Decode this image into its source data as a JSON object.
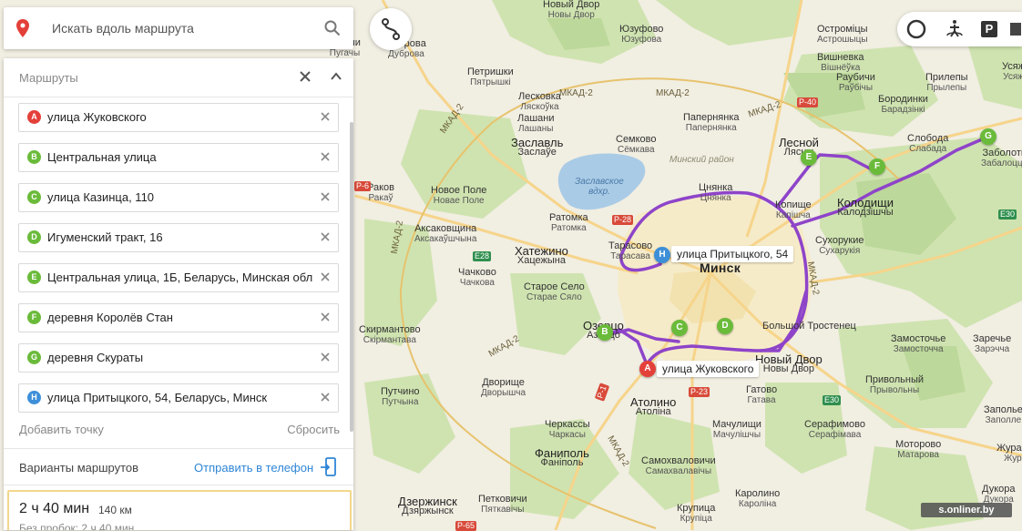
{
  "search": {
    "placeholder": "Искать вдоль маршрута"
  },
  "panel": {
    "title": "Маршруты",
    "waypoints": [
      {
        "letter": "A",
        "text": "улица Жуковского",
        "color": "#e4403a"
      },
      {
        "letter": "B",
        "text": "Центральная улица",
        "color": "#6bbb3b"
      },
      {
        "letter": "C",
        "text": "улица Казинца, 110",
        "color": "#6bbb3b"
      },
      {
        "letter": "D",
        "text": "Игуменский тракт, 16",
        "color": "#6bbb3b"
      },
      {
        "letter": "E",
        "text": "Центральная улица, 1Б, Беларусь, Минская обл",
        "color": "#6bbb3b"
      },
      {
        "letter": "F",
        "text": "деревня Королёв Стан",
        "color": "#6bbb3b"
      },
      {
        "letter": "G",
        "text": "деревня Скураты",
        "color": "#6bbb3b"
      },
      {
        "letter": "H",
        "text": "улица Притыцкого, 54, Беларусь, Минск",
        "color": "#3d8fd8"
      }
    ],
    "add_point": "Добавить точку",
    "reset": "Сбросить",
    "variants_title": "Варианты маршрутов",
    "send_to_phone": "Отправить в телефон",
    "route": {
      "time": "2 ч 40 мин",
      "distance": "140 км",
      "subtitle": "Без пробок: 2 ч 40 мин"
    }
  },
  "top_controls": {
    "parking_label": "P"
  },
  "map": {
    "route_color": "#8e44c9",
    "captions": {
      "a": "улица Жуковского",
      "h": "улица Притыцкого, 54"
    },
    "pins": {
      "a": "A",
      "b": "B",
      "c": "C",
      "d": "D",
      "e": "E",
      "f": "F",
      "g": "G",
      "h": "H"
    },
    "places": [
      {
        "ru": "Новый Двор",
        "by": "Новы Двор"
      },
      {
        "ru": "Юзуфово",
        "by": "Юзуфова"
      },
      {
        "ru": "Остроміцы",
        "by": "Астрошыцы"
      },
      {
        "ru": "Дубровa",
        "by": "Дуброва"
      },
      {
        "ru": "Пугачи",
        "by": "Пугачы"
      },
      {
        "ru": "Вишневка",
        "by": "Вішнёўка"
      },
      {
        "ru": "Петришки",
        "by": "Пятрышкі"
      },
      {
        "ru": "Лесковка",
        "by": "Ляскоўка"
      },
      {
        "ru": "Лашани",
        "by": "Лашаны"
      },
      {
        "ru": "Раубичи",
        "by": "Раўбічы"
      },
      {
        "ru": "Прилепы",
        "by": "Прылепы"
      },
      {
        "ru": "Бородинки",
        "by": "Барадзінкі"
      },
      {
        "ru": "Усяж",
        "by": "Усяж"
      },
      {
        "ru": "Семково",
        "by": "Сёмкава"
      },
      {
        "ru": "Папернянка",
        "by": "Папернянка"
      },
      {
        "ru": "Заславль",
        "by": "Заслаўе"
      },
      {
        "ru": "Лесной",
        "by": "Лясны"
      },
      {
        "ru": "Слобода",
        "by": "Слабада"
      },
      {
        "ru": "Заболоть",
        "by": "Забалоцце"
      },
      {
        "ru": "Раков",
        "by": "Ракаў"
      },
      {
        "ru": "Новое Поле",
        "by": "Новае Поле"
      },
      {
        "ru": "Ратомка",
        "by": "Ратомка"
      },
      {
        "ru": "Цнянка",
        "by": "Цнянка"
      },
      {
        "ru": "Копище",
        "by": "Капішча"
      },
      {
        "ru": "Колодищи",
        "by": "Калодзішчы"
      },
      {
        "ru": "Аксаковщина",
        "by": "Аксакаўшчына"
      },
      {
        "ru": "Хатежино",
        "by": "Хацежына"
      },
      {
        "ru": "Тарасово",
        "by": "Тарасава"
      },
      {
        "ru": "Минск",
        "by": ""
      },
      {
        "ru": "Сухорукие",
        "by": "Сухарукія"
      },
      {
        "ru": "Чачково",
        "by": "Чачкова"
      },
      {
        "ru": "Старое Село",
        "by": "Старае Сяло"
      },
      {
        "ru": "Скирмантово",
        "by": "Скірмантава"
      },
      {
        "ru": "Озерцо",
        "by": "Азярцо"
      },
      {
        "ru": "Большой Тростенец",
        "by": ""
      },
      {
        "ru": "Замосточье",
        "by": "Замосточча"
      },
      {
        "ru": "Заречье",
        "by": "Зарэчча"
      },
      {
        "ru": "Новый Двор",
        "by": "Новы Двор"
      },
      {
        "ru": "Привольный",
        "by": "Прывольны"
      },
      {
        "ru": "Путчино",
        "by": "Путчына"
      },
      {
        "ru": "Дворище",
        "by": "Двоpышча"
      },
      {
        "ru": "Гатово",
        "by": "Гатава"
      },
      {
        "ru": "Атолино",
        "by": "Атоліна"
      },
      {
        "ru": "Черкассы",
        "by": "Чаркасы"
      },
      {
        "ru": "Мачулищи",
        "by": "Мачулішчы"
      },
      {
        "ru": "Серафимово",
        "by": "Серафімава"
      },
      {
        "ru": "Заполье",
        "by": "Заполле"
      },
      {
        "ru": "Фаниполь",
        "by": "Фаніполь"
      },
      {
        "ru": "Самохваловичи",
        "by": "Самахвалавічы"
      },
      {
        "ru": "Моторово",
        "by": "Матарова"
      },
      {
        "ru": "Журавы",
        "by": "Жура"
      },
      {
        "ru": "Дзержинск",
        "by": "Дзяржынск"
      },
      {
        "ru": "Петковичи",
        "by": "Пяткавічы"
      },
      {
        "ru": "Каролино",
        "by": "Кароліна"
      },
      {
        "ru": "Крупица",
        "by": "Крупіца"
      },
      {
        "ru": "Дукора",
        "by": "Дукора"
      }
    ],
    "ring_labels": [
      "МКАД-2",
      "МКАД-2",
      "МКАД-2",
      "МКАД-2",
      "МКАД-2",
      "МКАД-2",
      "МКАД-2",
      "МКАД-2"
    ],
    "road_tags": [
      "Р-40",
      "Р-28",
      "Е28",
      "Е30",
      "Е30",
      "Р-23",
      "Р-1",
      "Р-6",
      "Р-65"
    ],
    "water": "Заславское вдхр.",
    "region": "Минский район",
    "watermark": "s.onliner.by"
  }
}
